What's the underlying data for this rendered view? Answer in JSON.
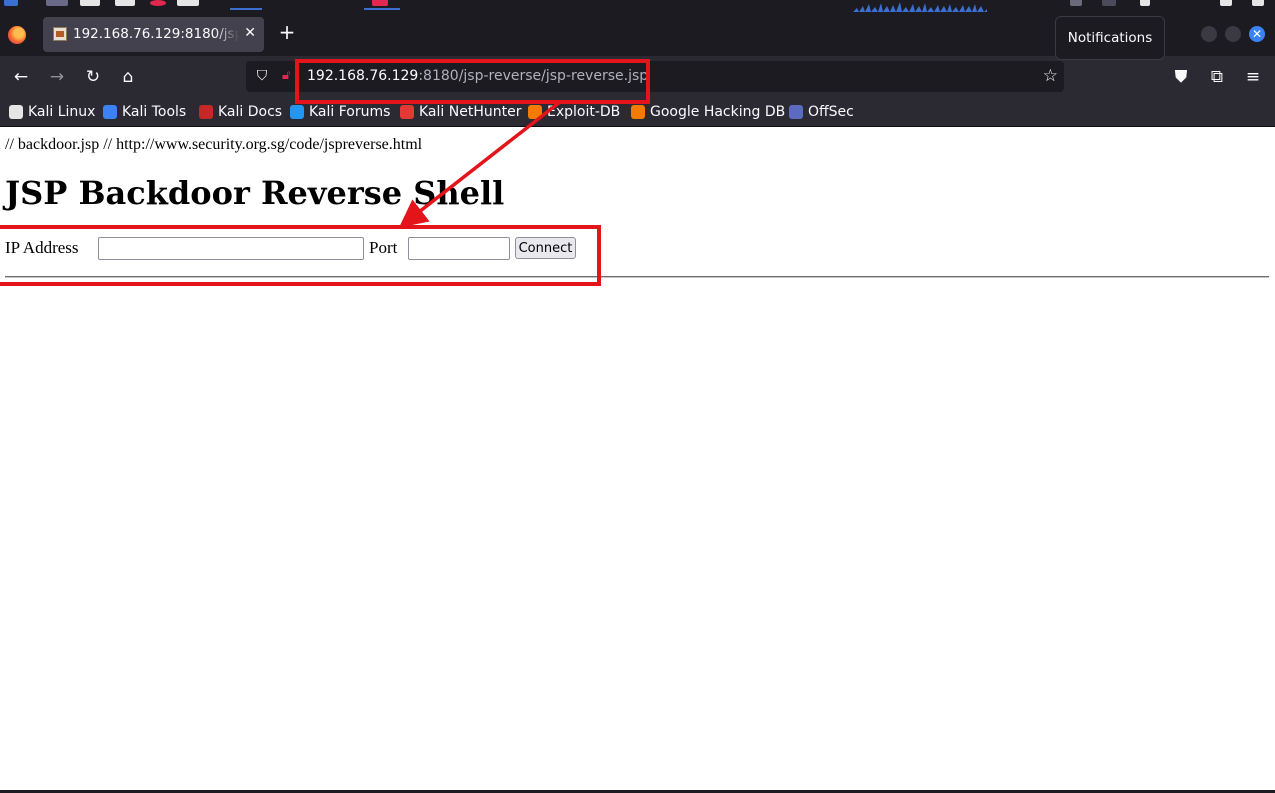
{
  "browser": {
    "tab": {
      "title": "192.168.76.129:8180/jsp-reverse/jsp-reverse.jsp"
    },
    "tooltip": "Notifications",
    "url": {
      "host": "192.168.76.129",
      "rest": ":8180/jsp-reverse/jsp-reverse.jsp"
    },
    "bookmarks": [
      {
        "label": "Kali Linux",
        "icon": "kali-dragon-icon",
        "color": "#e5e5e5"
      },
      {
        "label": "Kali Tools",
        "icon": "kali-tools-icon",
        "color": "#3b82f6"
      },
      {
        "label": "Kali Docs",
        "icon": "kali-docs-icon",
        "color": "#c62828"
      },
      {
        "label": "Kali Forums",
        "icon": "kali-forums-icon",
        "color": "#2196f3"
      },
      {
        "label": "Kali NetHunter",
        "icon": "nethunter-icon",
        "color": "#e53935"
      },
      {
        "label": "Exploit-DB",
        "icon": "exploit-db-icon",
        "color": "#f57c00"
      },
      {
        "label": "Google Hacking DB",
        "icon": "ghdb-icon",
        "color": "#f57c00"
      },
      {
        "label": "OffSec",
        "icon": "offsec-icon",
        "color": "#5c6bc0"
      }
    ]
  },
  "page": {
    "comment": "// backdoor.jsp // http://www.security.org.sg/code/jspreverse.html",
    "heading": "JSP Backdoor Reverse Shell",
    "form": {
      "ip_label": "IP Address",
      "ip_value": "",
      "port_label": "Port",
      "port_value": "",
      "connect_label": "Connect"
    }
  },
  "colors": {
    "annotation": "#e4141b",
    "browser_dark": "#1c1b22",
    "toolbar": "#2b2a33"
  }
}
